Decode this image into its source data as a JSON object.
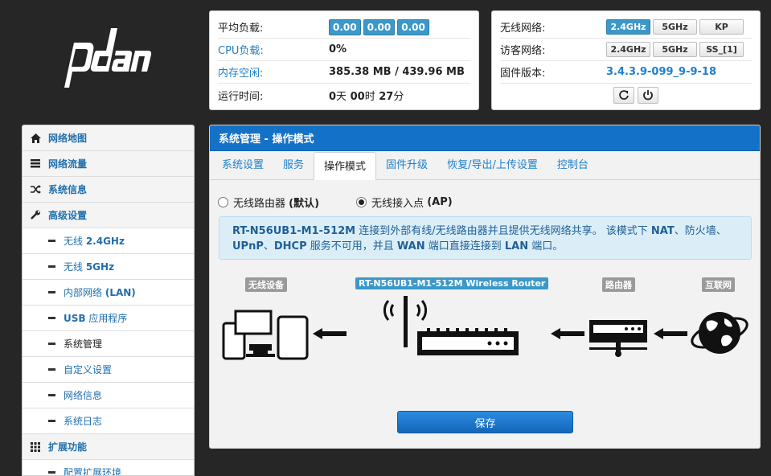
{
  "logo": {
    "name": "padavan-logo"
  },
  "status": {
    "avg_load_label": "平均负载:",
    "avg_load_values": [
      "0.00",
      "0.00",
      "0.00"
    ],
    "cpu_label": "CPU负载:",
    "cpu_value": "0%",
    "mem_label": "内存空闲:",
    "mem_value": "385.38 MB / 439.96 MB",
    "uptime_label": "运行时间:",
    "uptime": {
      "days": "0",
      "days_unit": "天",
      "hours": "00",
      "hours_unit": "时",
      "mins": "27",
      "mins_unit": "分"
    }
  },
  "wireless": {
    "wifi_label": "无线网络:",
    "wifi_buttons": [
      "2.4GHz",
      "5GHz",
      "KP"
    ],
    "guest_label": "访客网络:",
    "guest_buttons": [
      "2.4GHz",
      "5GHz",
      "SS_[1]"
    ],
    "fw_label": "固件版本:",
    "fw_value": "3.4.3.9-099_9-9-18",
    "icons": [
      "refresh-icon",
      "power-icon"
    ]
  },
  "sidebar": {
    "items": [
      {
        "label": "网络地图",
        "icon": "home-icon",
        "level": "top"
      },
      {
        "label": "网络流量",
        "icon": "list-icon",
        "level": "top"
      },
      {
        "label": "系统信息",
        "icon": "shuffle-icon",
        "level": "top"
      },
      {
        "label": "高级设置",
        "icon": "wrench-icon",
        "level": "top"
      },
      {
        "label_pre": "无线 ",
        "label_bold": "2.4GHz",
        "level": "sub"
      },
      {
        "label_pre": "无线 ",
        "label_bold": "5GHz",
        "level": "sub"
      },
      {
        "label_pre": "内部网络 ",
        "label_bold": "(LAN)",
        "level": "sub"
      },
      {
        "label_bold": "USB",
        "label_post": " 应用程序",
        "level": "sub"
      },
      {
        "label_pre": "系统管理",
        "level": "sub",
        "current": true
      },
      {
        "label_pre": "自定义设置",
        "level": "sub"
      },
      {
        "label_pre": "网络信息",
        "level": "sub"
      },
      {
        "label_pre": "系统日志",
        "level": "sub"
      },
      {
        "label": "扩展功能",
        "icon": "grid-icon",
        "level": "top"
      },
      {
        "label_pre": "配置扩展环境",
        "level": "sub"
      }
    ]
  },
  "main": {
    "title": "系统管理 - 操作模式",
    "tabs": [
      "系统设置",
      "服务",
      "操作模式",
      "固件升级",
      "恢复/导出/上传设置",
      "控制台"
    ],
    "active_tab": 2,
    "mode_options": [
      {
        "text": "无线路由器 ",
        "bold": "(默认)",
        "selected": false
      },
      {
        "text": "无线接入点 ",
        "bold": "(AP)",
        "selected": true
      }
    ],
    "info": {
      "p1_bold": "RT-N56UB1-M1-512M",
      "p1": " 连接到外部有线/无线路由器并且提供无线网络共享。 该模式下 ",
      "nat": "NAT",
      "p2": "、防火墙、",
      "upnp": "UPnP",
      "p3": "、",
      "dhcp": "DHCP",
      "p4": " 服务不可用，并且 ",
      "wan": "WAN",
      "p5": " 端口直接连接到 ",
      "lan": "LAN",
      "p6": " 端口。"
    },
    "diagram": {
      "devices_label": "无线设备",
      "router_label": "RT-N56UB1-M1-512M Wireless Router",
      "upstream_label": "路由器",
      "internet_label": "互联网"
    },
    "save_label": "保存"
  }
}
